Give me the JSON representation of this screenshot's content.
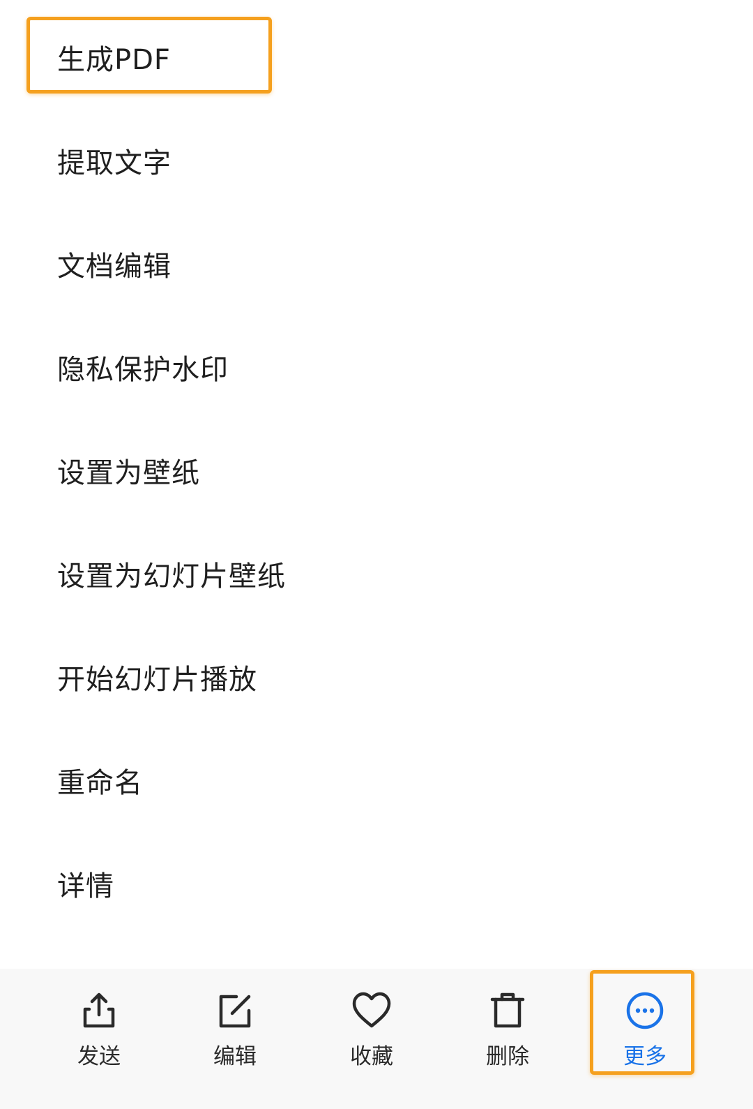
{
  "menu": {
    "items": [
      {
        "label": "生成PDF"
      },
      {
        "label": "提取文字"
      },
      {
        "label": "文档编辑"
      },
      {
        "label": "隐私保护水印"
      },
      {
        "label": "设置为壁纸"
      },
      {
        "label": "设置为幻灯片壁纸"
      },
      {
        "label": "开始幻灯片播放"
      },
      {
        "label": "重命名"
      },
      {
        "label": "详情"
      }
    ]
  },
  "toolbar": {
    "items": [
      {
        "label": "发送",
        "icon": "share-icon"
      },
      {
        "label": "编辑",
        "icon": "edit-icon"
      },
      {
        "label": "收藏",
        "icon": "heart-icon"
      },
      {
        "label": "删除",
        "icon": "trash-icon"
      },
      {
        "label": "更多",
        "icon": "more-icon",
        "active": true
      }
    ]
  },
  "colors": {
    "highlight": "#f5a01e",
    "active": "#1a73e8",
    "text": "#1f1f1f",
    "toolbar_bg": "#f8f8f8"
  }
}
